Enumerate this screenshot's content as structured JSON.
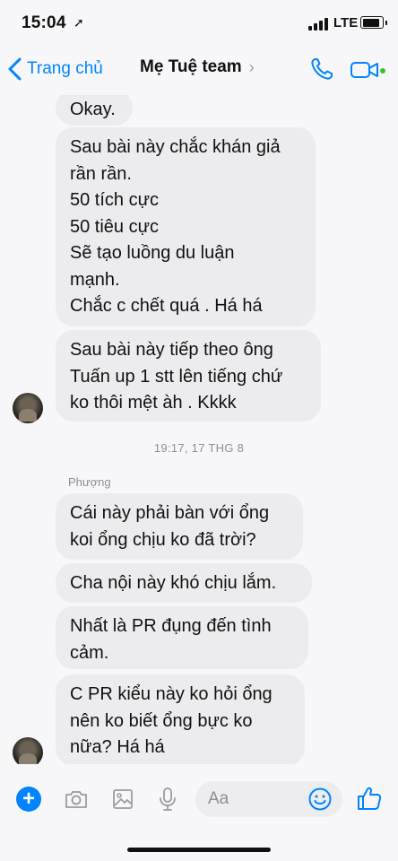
{
  "status": {
    "time": "15:04",
    "network": "LTE"
  },
  "nav": {
    "back_label": "Trang chủ",
    "title": "Mẹ Tuệ team",
    "title_chevron": "›"
  },
  "messages": [
    {
      "text": "Okay."
    },
    {
      "text": "Sau bài này chắc khán giả\nrần rần.\n50 tích cực\n50 tiêu cực\nSẽ tạo luồng du luận\nmạnh.\nChắc c chết quá . Há há"
    },
    {
      "text": "Sau bài này tiếp theo ông\nTuấn up 1 stt lên tiếng chứ\nko thôi mệt àh . Kkkk"
    }
  ],
  "timestamp": "19:17, 17 THG 8",
  "sender": "Phượng",
  "messages_2": [
    {
      "text": "Cái này phải bàn với ổng\nkoi ổng chịu ko đã trời?"
    },
    {
      "text": "Cha nội này khó chịu lắm."
    },
    {
      "text": "Nhất là PR đụng đến tình\ncảm."
    },
    {
      "text": "C PR kiểu này ko hỏi ổng\nnên ko biết ổng bực ko\nnữa? Há há"
    }
  ],
  "composer": {
    "placeholder": "Aa",
    "plus": "+"
  },
  "colors": {
    "accent": "#0084ff",
    "bubble": "#ececee",
    "online": "#44bd32"
  },
  "icons": [
    "location-arrow-icon",
    "signal-icon",
    "battery-icon",
    "back-chevron-icon",
    "phone-icon",
    "video-camera-icon",
    "plus-icon",
    "camera-icon",
    "photo-icon",
    "microphone-icon",
    "emoji-icon",
    "thumbs-up-icon"
  ]
}
